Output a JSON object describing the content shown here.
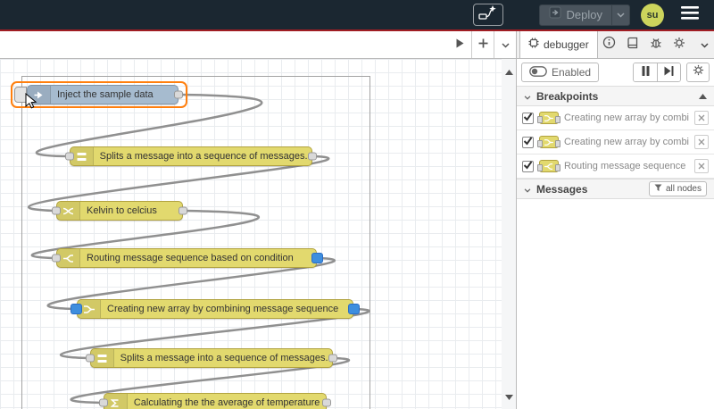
{
  "header": {
    "deploy": {
      "label": "Deploy"
    },
    "avatar": {
      "initials": "su"
    }
  },
  "flow": {
    "nodes": [
      {
        "label": "Inject the sample data",
        "type": "inject",
        "selected": true
      },
      {
        "label": "Splits a message into a sequence of messages.",
        "type": "split"
      },
      {
        "label": "Kelvin to celcius",
        "type": "change"
      },
      {
        "label": "Routing message sequence based on condition",
        "type": "switch",
        "breakpoints": [
          "output"
        ]
      },
      {
        "label": "Creating new array by combining message sequence",
        "type": "join",
        "breakpoints": [
          "input",
          "output"
        ]
      },
      {
        "label": "Splits a message into a sequence of messages.",
        "type": "split"
      },
      {
        "label": "Calculating the the average of temperature",
        "type": "function"
      }
    ]
  },
  "sidebar": {
    "tab": {
      "label": "debugger"
    },
    "controls": {
      "enabled_label": "Enabled"
    },
    "breakpoints": {
      "title": "Breakpoints",
      "items": [
        {
          "label": "Creating new array by combining message sequence",
          "type": "join"
        },
        {
          "label": "Creating new array by combining message sequence",
          "type": "join"
        },
        {
          "label": "Routing message sequence based on condition",
          "type": "switch"
        }
      ]
    },
    "messages": {
      "title": "Messages",
      "filter_label": "all nodes"
    }
  },
  "colors": {
    "header_bg": "#1b2731",
    "accent_line": "#a01d23",
    "node_yellow": "#e2d96e",
    "node_inject": "#a6bbcf",
    "selection": "#ff7f0e",
    "breakpoint_blue": "#3e8ede",
    "avatar_bg": "#ccd45c"
  },
  "icons": [
    "ai-node-icon",
    "deploy-icon",
    "chevron-down-icon",
    "hamburger-icon",
    "play-icon",
    "plus-icon",
    "info-icon",
    "book-icon",
    "bug-icon",
    "gear-icon",
    "pause-icon",
    "step-icon",
    "toggle-icon",
    "check-icon",
    "close-icon",
    "funnel-icon",
    "inject-icon",
    "split-icon",
    "change-icon",
    "switch-icon",
    "join-icon",
    "function-icon",
    "scroll-up-icon",
    "scroll-down-icon"
  ]
}
